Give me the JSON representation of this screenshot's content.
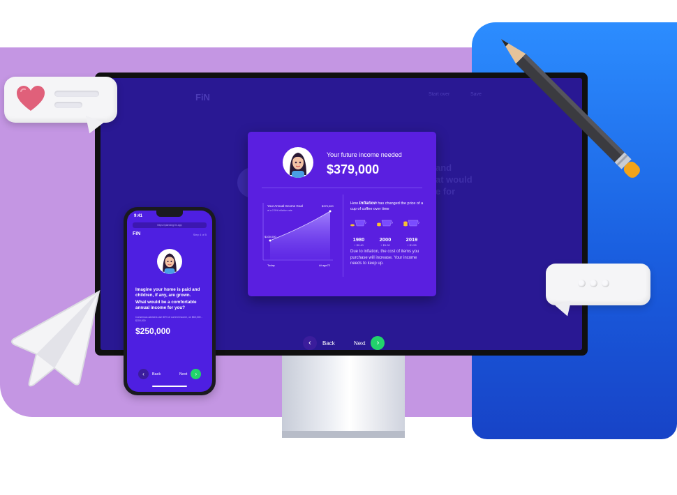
{
  "colors": {
    "purple_backdrop": "#c496e3",
    "blue_backdrop": "#1f6ff0",
    "screen_bg": "#291893",
    "modal_bg": "#5a1fe0",
    "accent_green": "#22d36c",
    "back_button": "#3b1d9c"
  },
  "desktop": {
    "logo": "FiN",
    "header_links": [
      "Start over",
      "Save"
    ],
    "card": {
      "title": "Your future income needed",
      "amount": "$379,000",
      "chart": {
        "title": "Your Annual Income Goal",
        "subtitle": "at a 2.5% inflation rate",
        "start_label": "$100,000",
        "end_label": "$379,000",
        "x_start": "Today",
        "x_end": "At age72"
      },
      "inflation_text_prefix": "How",
      "inflation_word": "Inflation",
      "inflation_text_suffix": "has changed the price of a cup of coffee over time",
      "cups": [
        {
          "year": "1980",
          "price": "+ $0.40"
        },
        {
          "year": "2000",
          "price": "+ $1.00"
        },
        {
          "year": "2019",
          "price": "+ $1.55"
        }
      ],
      "note": "Due to inflation, the cost of items you purchase will increase. Your income needs to keep up."
    },
    "back_label": "Back",
    "next_label": "Next",
    "back_icon": "chevron-left-icon",
    "next_icon": "chevron-right-icon"
  },
  "mobile": {
    "time": "9:41",
    "url": "https://planning.fin.app",
    "logo": "FiN",
    "step": "Step 4 of 5",
    "question_1": "Imagine your home is paid and children, if any, are grown.",
    "question_2": "What would be a comfortable annual income for you?",
    "note": "Consensus advisers use 80% of current income, on $60,000 - $200,000",
    "amount": "$250,000",
    "back_label": "Back",
    "next_label": "Next"
  }
}
